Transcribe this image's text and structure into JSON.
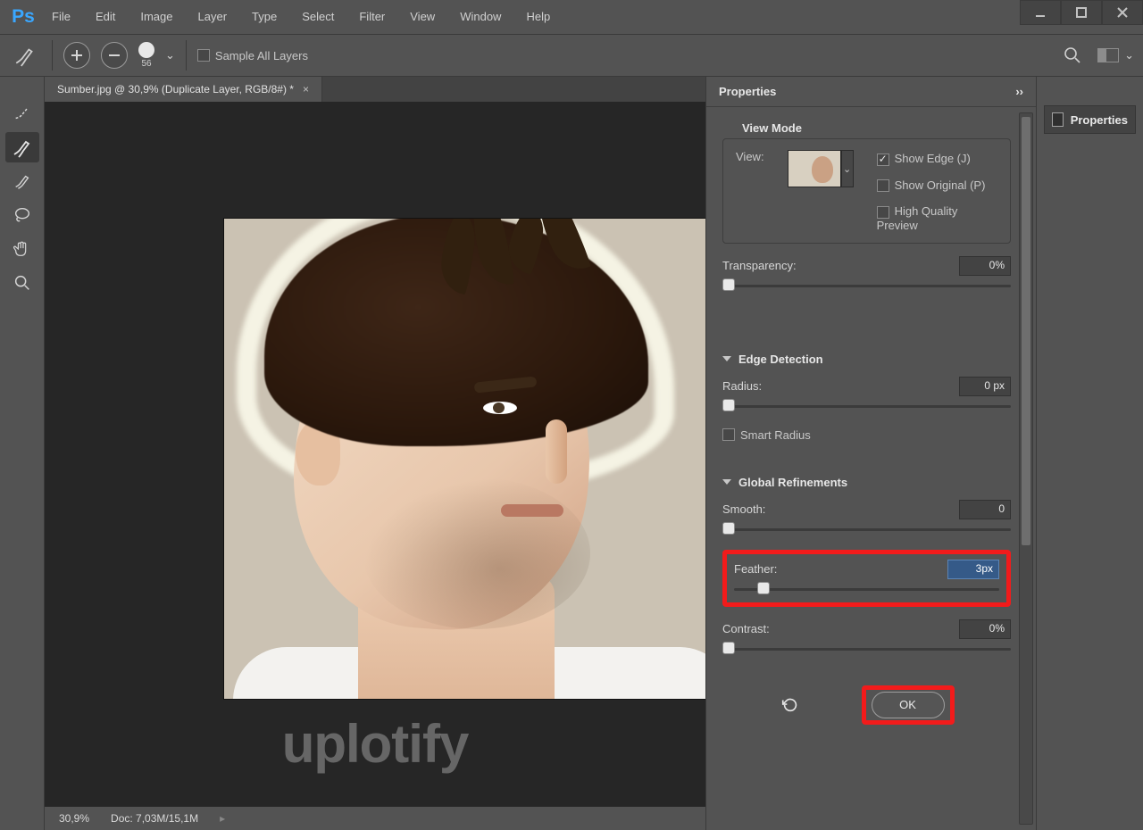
{
  "menu": {
    "items": [
      "File",
      "Edit",
      "Image",
      "Layer",
      "Type",
      "Select",
      "Filter",
      "View",
      "Window",
      "Help"
    ],
    "logo": "Ps"
  },
  "optionsbar": {
    "brush_size": "56",
    "sample_all_layers": "Sample All Layers"
  },
  "toolbar": {
    "tools": [
      "quick-select",
      "refine-brush",
      "brush",
      "lasso",
      "hand",
      "zoom"
    ]
  },
  "doc": {
    "tab_title": "Sumber.jpg @ 30,9% (Duplicate Layer, RGB/8#) *",
    "zoom": "30,9%",
    "docinfo": "Doc:  7,03M/15,1M"
  },
  "panel": {
    "title": "Properties",
    "view_mode_title": "View Mode",
    "view_label": "View:",
    "show_edge": "Show Edge (J)",
    "show_original": "Show Original (P)",
    "high_quality": "High Quality Preview",
    "transparency_label": "Transparency:",
    "transparency_value": "0%",
    "edge_detection_title": "Edge Detection",
    "radius_label": "Radius:",
    "radius_value": "0 px",
    "smart_radius": "Smart Radius",
    "global_refine_title": "Global Refinements",
    "smooth_label": "Smooth:",
    "smooth_value": "0",
    "feather_label": "Feather:",
    "feather_value": "3px",
    "contrast_label": "Contrast:",
    "contrast_value": "0%",
    "ok": "OK"
  },
  "right": {
    "properties_tab": "Properties"
  },
  "watermark": "uplotify"
}
